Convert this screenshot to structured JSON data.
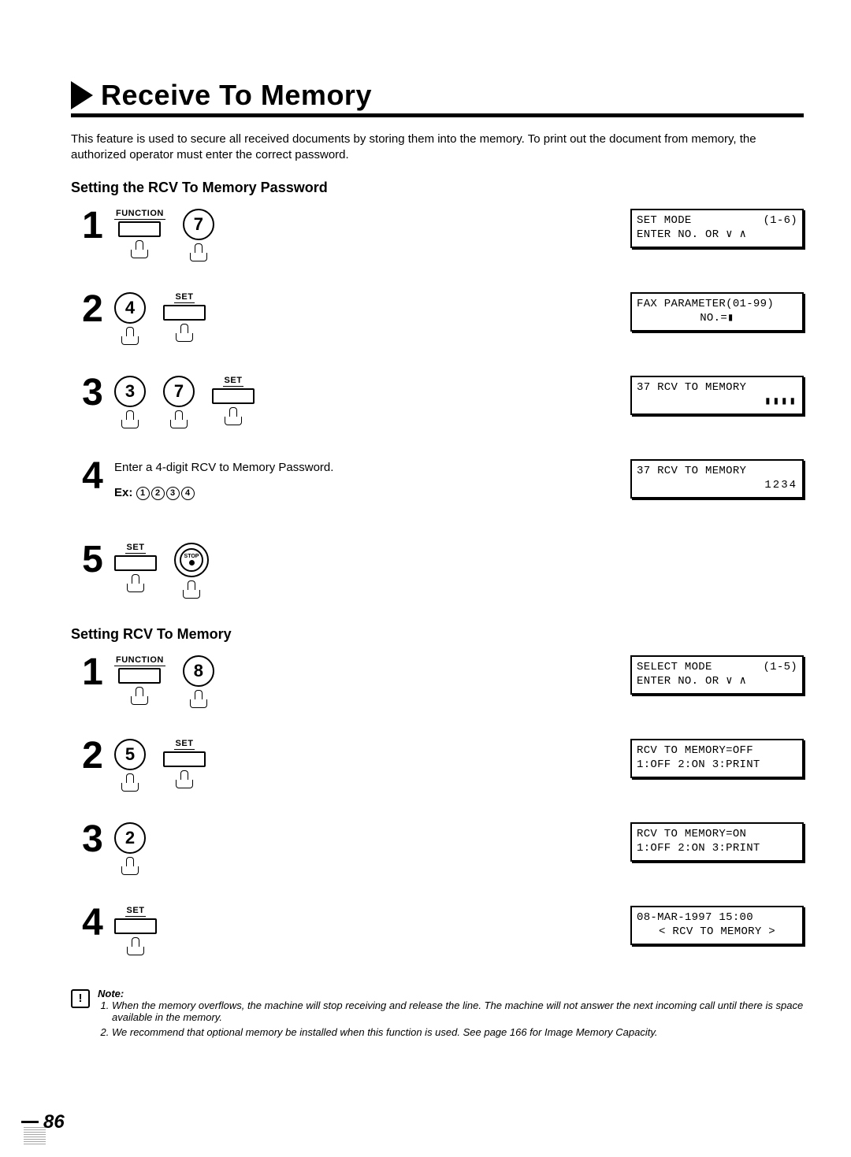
{
  "title": "Receive To Memory",
  "intro": "This feature is used to secure all received documents by storing them into the memory. To print out the document from memory, the authorized operator must enter the correct password.",
  "sectionA": {
    "heading": "Setting the RCV To Memory Password",
    "steps": [
      {
        "num": "1",
        "keys": [
          {
            "kind": "fn",
            "label": "FUNCTION"
          },
          {
            "kind": "digit",
            "label": "7"
          }
        ],
        "lcd": {
          "l1": "SET MODE",
          "r1": "(1-6)",
          "l2": "ENTER NO. OR ∨ ∧"
        }
      },
      {
        "num": "2",
        "keys": [
          {
            "kind": "digit",
            "label": "4"
          },
          {
            "kind": "set",
            "label": "SET"
          }
        ],
        "lcd": {
          "l1": "FAX PARAMETER(01-99)",
          "c2": "NO.=▮"
        }
      },
      {
        "num": "3",
        "keys": [
          {
            "kind": "digit",
            "label": "3"
          },
          {
            "kind": "digit",
            "label": "7"
          },
          {
            "kind": "set",
            "label": "SET"
          }
        ],
        "lcd": {
          "l1": "37 RCV TO MEMORY",
          "r2": "▮▮▮▮"
        }
      },
      {
        "num": "4",
        "text": "Enter a 4-digit RCV to Memory Password.",
        "ex_label": "Ex:",
        "ex_digits": [
          "1",
          "2",
          "3",
          "4"
        ],
        "lcd": {
          "l1": "37 RCV TO MEMORY",
          "r2": "1234"
        }
      },
      {
        "num": "5",
        "keys": [
          {
            "kind": "set",
            "label": "SET"
          },
          {
            "kind": "stop",
            "label": "STOP"
          }
        ]
      }
    ]
  },
  "sectionB": {
    "heading": "Setting RCV To Memory",
    "steps": [
      {
        "num": "1",
        "keys": [
          {
            "kind": "fn",
            "label": "FUNCTION"
          },
          {
            "kind": "digit",
            "label": "8"
          }
        ],
        "lcd": {
          "l1": "SELECT MODE",
          "r1": "(1-5)",
          "l2": "ENTER NO. OR ∨ ∧"
        }
      },
      {
        "num": "2",
        "keys": [
          {
            "kind": "digit",
            "label": "5"
          },
          {
            "kind": "set",
            "label": "SET"
          }
        ],
        "lcd": {
          "l1": "RCV TO MEMORY=OFF",
          "l2": "1:OFF 2:ON 3:PRINT"
        }
      },
      {
        "num": "3",
        "keys": [
          {
            "kind": "digit",
            "label": "2"
          }
        ],
        "lcd": {
          "l1": "RCV TO MEMORY=ON",
          "l2": "1:OFF 2:ON 3:PRINT"
        }
      },
      {
        "num": "4",
        "keys": [
          {
            "kind": "set",
            "label": "SET"
          }
        ],
        "lcd": {
          "l1": "08-MAR-1997 15:00",
          "c2": "< RCV TO MEMORY >"
        }
      }
    ]
  },
  "note_label": "Note:",
  "notes": [
    "When the memory overflows, the machine will stop receiving and release the line. The machine will not answer the next incoming call until there is space available in the memory.",
    "We recommend that optional memory be installed when this function is used. See page 166 for Image Memory Capacity."
  ],
  "page_number": "86"
}
